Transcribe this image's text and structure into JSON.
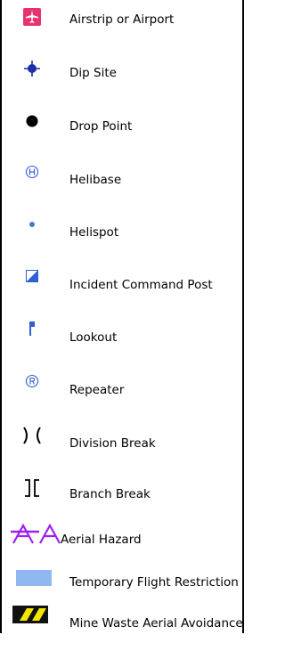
{
  "legend": {
    "items": [
      {
        "label": "Airstrip or Airport",
        "icon": "airplane-icon",
        "color": "#e8336e"
      },
      {
        "label": "Dip Site",
        "icon": "dip-site-crosshair-icon",
        "color": "#1a2fa8"
      },
      {
        "label": "Drop Point",
        "icon": "drop-point-dot-icon",
        "color": "#000000"
      },
      {
        "label": "Helibase",
        "icon": "helibase-circled-h-icon",
        "color": "#2f5fd0"
      },
      {
        "label": "Helispot",
        "icon": "helispot-dot-icon",
        "color": "#4a78d0"
      },
      {
        "label": "Incident Command Post",
        "icon": "command-post-flag-icon",
        "color": "#2f5fd0"
      },
      {
        "label": "Lookout",
        "icon": "lookout-flag-icon",
        "color": "#2f5fd0"
      },
      {
        "label": "Repeater",
        "icon": "repeater-circled-r-icon",
        "color": "#2f5fd0"
      },
      {
        "label": "Division Break",
        "icon": "division-break-icon",
        "color": "#000000"
      },
      {
        "label": "Branch Break",
        "icon": "branch-break-icon",
        "color": "#000000"
      },
      {
        "label": "Aerial Hazard",
        "icon": "aerial-hazard-icon",
        "color": "#a020f0"
      },
      {
        "label": "Temporary Flight Restriction",
        "icon": "flight-restriction-swatch-icon",
        "color": "#8fb8f0"
      },
      {
        "label": "Mine Waste Aerial Avoidance",
        "icon": "mine-waste-swatch-icon",
        "color": "#f2e600"
      }
    ]
  }
}
